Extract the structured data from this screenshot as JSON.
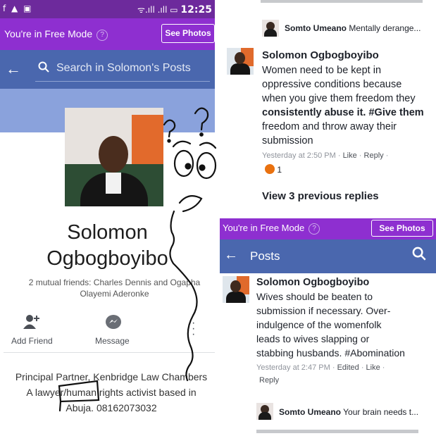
{
  "left": {
    "status": {
      "left_icons": "f ▲ ▣",
      "right_icons": "ᯤ.ıll .ıll ▭",
      "time": "12:25"
    },
    "free_mode": {
      "text": "You're in Free Mode",
      "help": "?",
      "button": "See Photos"
    },
    "search": {
      "back": "←",
      "placeholder": "Search in Solomon's Posts"
    },
    "profile": {
      "name_line1": "Solomon",
      "name_line2": "Ogbogboyibo",
      "mutual_line1": "2 mutual friends: Charles Dennis and Ogapha",
      "mutual_line2": "Olayemi Aderonke"
    },
    "actions": {
      "add_friend": "Add Friend",
      "message": "Message"
    },
    "bio": {
      "line1": "Principal Partner, Kenbridge Law Chambers",
      "line2": "A lawyer/human rights activist based in",
      "line3": "Abuja. 08162073032"
    }
  },
  "right_top": {
    "reply1": {
      "name": "Somto Umeano",
      "text": "Mentally derange..."
    },
    "comment": {
      "author": "Solomon Ogbogboyibo",
      "lines": [
        "Women need to be kept in",
        "oppressive conditions because",
        "when you give them freedom they",
        "consistently abuse it. #Give them",
        "freedom and throw away their",
        "submission"
      ],
      "time": "Yesterday at 2:50 PM",
      "like": "Like",
      "reply": "Reply",
      "reaction_count": "1"
    },
    "view_previous": "View 3 previous replies"
  },
  "right_bottom": {
    "free_mode": {
      "text": "You're in Free Mode",
      "help": "?",
      "button": "See Photos"
    },
    "header": {
      "back": "←",
      "title": "Posts"
    },
    "post": {
      "author": "Solomon Ogbogboyibo",
      "lines": [
        "Wives should be beaten to",
        "submission if necessary. Over-",
        "indulgence of the womenfolk",
        "leads to wives slapping or",
        "stabbing husbands. #Abomination"
      ],
      "time": "Yesterday at 2:47 PM",
      "edited": "Edited",
      "like": "Like",
      "reply": "Reply"
    },
    "reply": {
      "name": "Somto Umeano",
      "text": "Your brain needs t..."
    }
  },
  "colors": {
    "free_mode_purple": "#8e2fd0",
    "facebook_blue": "#4a67ae",
    "meta_gray": "#90949c"
  }
}
